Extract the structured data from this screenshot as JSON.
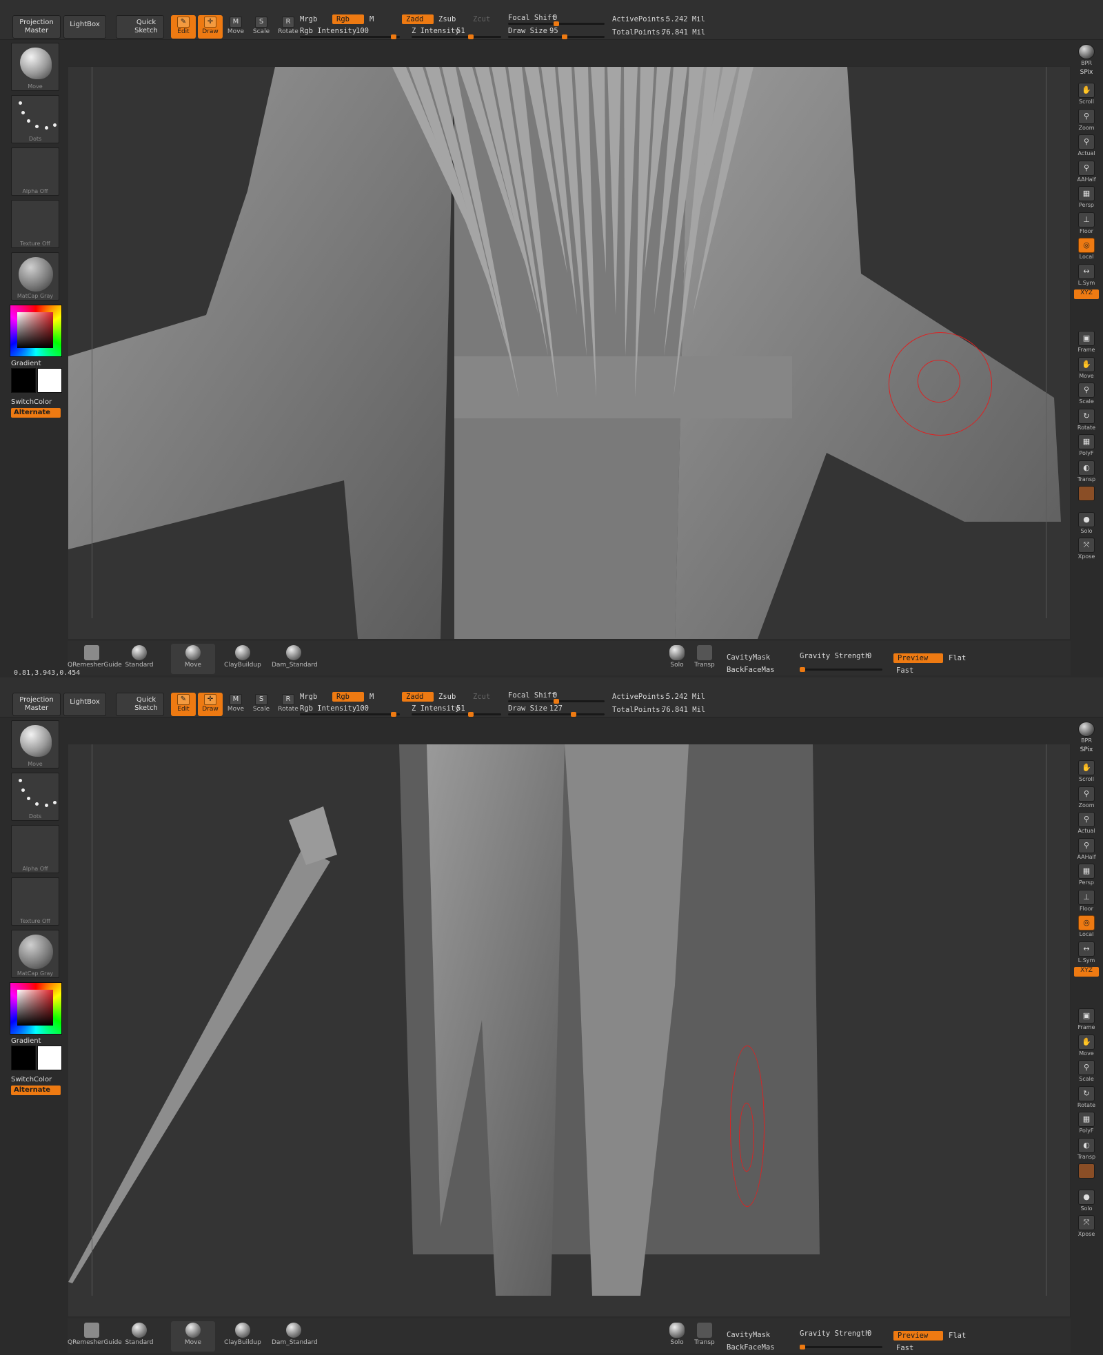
{
  "panels": [
    {
      "coord_readout": "",
      "toolbar": {
        "projection_master": "Projection Master",
        "lightbox": "LightBox",
        "quick_sketch": "Quick Sketch",
        "tools": [
          {
            "key": "edit",
            "glyph": "✎",
            "label": "Edit",
            "active": true
          },
          {
            "key": "draw",
            "glyph": "✛",
            "label": "Draw",
            "active": true
          },
          {
            "key": "move",
            "glyph": "M",
            "label": "Move",
            "active": false
          },
          {
            "key": "scale",
            "glyph": "S",
            "label": "Scale",
            "active": false
          },
          {
            "key": "rotate",
            "glyph": "R",
            "label": "Rotate",
            "active": false
          }
        ],
        "mrgb": "Mrgb",
        "rgb": "Rgb",
        "m": "M",
        "rgb_intensity_label": "Rgb Intensity",
        "rgb_intensity": "100",
        "zadd": "Zadd",
        "zsub": "Zsub",
        "zcut": "Zcut",
        "z_intensity_label": "Z Intensity",
        "z_intensity": "51",
        "focal_shift_label": "Focal Shift",
        "focal_shift": "0",
        "draw_size_label": "Draw Size",
        "draw_size": "95",
        "active_points_label": "ActivePoints:",
        "active_points": "5.242 Mil",
        "total_points_label": "TotalPoints:",
        "total_points": "76.841 Mil"
      }
    },
    {
      "coord_readout": "0.81,3.943,0.454",
      "toolbar": {
        "projection_master": "Projection Master",
        "lightbox": "LightBox",
        "quick_sketch": "Quick Sketch",
        "tools": [
          {
            "key": "edit",
            "glyph": "✎",
            "label": "Edit",
            "active": true
          },
          {
            "key": "draw",
            "glyph": "✛",
            "label": "Draw",
            "active": true
          },
          {
            "key": "move",
            "glyph": "M",
            "label": "Move",
            "active": false
          },
          {
            "key": "scale",
            "glyph": "S",
            "label": "Scale",
            "active": false
          },
          {
            "key": "rotate",
            "glyph": "R",
            "label": "Rotate",
            "active": false
          }
        ],
        "mrgb": "Mrgb",
        "rgb": "Rgb",
        "m": "M",
        "rgb_intensity_label": "Rgb Intensity",
        "rgb_intensity": "100",
        "zadd": "Zadd",
        "zsub": "Zsub",
        "zcut": "Zcut",
        "z_intensity_label": "Z Intensity",
        "z_intensity": "51",
        "focal_shift_label": "Focal Shift",
        "focal_shift": "0",
        "draw_size_label": "Draw Size",
        "draw_size": "127",
        "active_points_label": "ActivePoints:",
        "active_points": "5.242 Mil",
        "total_points_label": "TotalPoints:",
        "total_points": "76.841 Mil"
      }
    }
  ],
  "left_shelf": {
    "brush_caption": "Move",
    "stroke_caption": "Dots",
    "alpha_caption": "Alpha Off",
    "texture_caption": "Texture Off",
    "material_caption": "MatCap Gray",
    "gradient_label": "Gradient",
    "switch_color_label": "SwitchColor",
    "alternate_label": "Alternate",
    "main_color": "#000000",
    "secondary_color": "#ffffff"
  },
  "bottom_shelf": {
    "brushes": [
      {
        "label": "QRemesherGuide",
        "selected": false
      },
      {
        "label": "Standard",
        "selected": false
      },
      {
        "label": "Move",
        "selected": true
      },
      {
        "label": "ClayBuildup",
        "selected": false
      },
      {
        "label": "Dam_Standard",
        "selected": false
      }
    ],
    "solo": "Solo",
    "transp": "Transp",
    "cavity_mask": "CavityMask",
    "backface_mask": "BackFaceMas",
    "gravity_strength_label": "Gravity Strength",
    "gravity_strength": "0",
    "preview": "Preview",
    "flat": "Flat",
    "fast": "Fast"
  },
  "right_shelf": {
    "bpr": "BPR",
    "spix": "SPix",
    "buttons": [
      {
        "key": "scroll",
        "glyph": "✋",
        "label": "Scroll"
      },
      {
        "key": "zoom",
        "glyph": "⚲",
        "label": "Zoom"
      },
      {
        "key": "actual",
        "glyph": "⚲",
        "label": "Actual"
      },
      {
        "key": "aahalf",
        "glyph": "⚲",
        "label": "AAHalf"
      },
      {
        "key": "persp",
        "glyph": "▦",
        "label": "Persp"
      },
      {
        "key": "floor",
        "glyph": "⊥",
        "label": "Floor"
      },
      {
        "key": "local",
        "glyph": "◎",
        "label": "Local"
      },
      {
        "key": "lsym",
        "glyph": "↔",
        "label": "L.Sym"
      }
    ],
    "xyz": "XYZ",
    "buttons2": [
      {
        "key": "frame",
        "glyph": "▣",
        "label": "Frame"
      },
      {
        "key": "move",
        "glyph": "✋",
        "label": "Move"
      },
      {
        "key": "scale",
        "glyph": "⚲",
        "label": "Scale"
      },
      {
        "key": "rotate",
        "glyph": "↻",
        "label": "Rotate"
      },
      {
        "key": "polyf",
        "glyph": "▦",
        "label": "PolyF"
      },
      {
        "key": "transp",
        "glyph": "◐",
        "label": "Transp"
      },
      {
        "key": "ghost",
        "glyph": "",
        "label": ""
      },
      {
        "key": "solo",
        "glyph": "●",
        "label": "Solo"
      },
      {
        "key": "xpose",
        "glyph": "⤧",
        "label": "Xpose"
      }
    ]
  },
  "colors": {
    "accent": "#ee7a12",
    "background": "#2b2b2b",
    "viewport": "#343434",
    "brush_ring": "#d22222"
  }
}
